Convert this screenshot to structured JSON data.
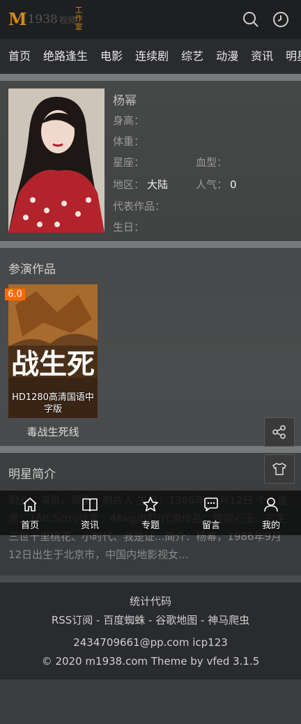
{
  "header": {
    "logo_m": "M",
    "logo_num": "1938",
    "logo_cn": "视频",
    "logo_badge": "工作室",
    "search_icon": "search-icon",
    "history_icon": "clock-icon"
  },
  "nav": {
    "items": [
      "首页",
      "绝路逢生",
      "电影",
      "连续剧",
      "综艺",
      "动漫",
      "资讯",
      "明星"
    ]
  },
  "profile": {
    "name": "杨幂",
    "height_label": "身高：",
    "weight_label": "体重：",
    "constellation_label": "星座：",
    "blood_label": "血型：",
    "region_label": "地区：",
    "region_value": "大陆",
    "popularity_label": "人气：",
    "popularity_value": "0",
    "works_label": "代表作品：",
    "birthday_label": "生日："
  },
  "works": {
    "title": "参演作品",
    "items": [
      {
        "score": "6.0",
        "poster_caption": "HD1280高清国语中字版",
        "poster_art_text": "战生死",
        "title": "毒战生死线"
      }
    ]
  },
  "bio": {
    "title": "明星简介",
    "text": "职业：演员、歌手、制片人 生日：1986年09月12日 个人信息：166.5cm/体重：48kg/B型/代表作品：宫锁心玉、三生三世十里桃花、小时代、我是证...简介：杨幂，1986年9月12日出生于北京市，中国内地影视女..."
  },
  "tabbar": {
    "items": [
      {
        "label": "首页",
        "icon": "home-icon"
      },
      {
        "label": "资讯",
        "icon": "book-icon"
      },
      {
        "label": "专题",
        "icon": "star-icon"
      },
      {
        "label": "留言",
        "icon": "chat-icon"
      },
      {
        "label": "我的",
        "icon": "user-icon"
      }
    ]
  },
  "float_buttons": {
    "share_icon": "share-icon",
    "shirt_icon": "shirt-icon"
  },
  "footer": {
    "stats": "统计代码",
    "links": "RSS订阅 - 百度蜘蛛 - 谷歌地图 - 神马爬虫",
    "contact": "2434709661@pp.com   icp123",
    "copyright": "© 2020 m1938.com Theme by vfed 3.1.5"
  },
  "colors": {
    "accent": "#ff6a00",
    "logo": "#d4891c"
  }
}
